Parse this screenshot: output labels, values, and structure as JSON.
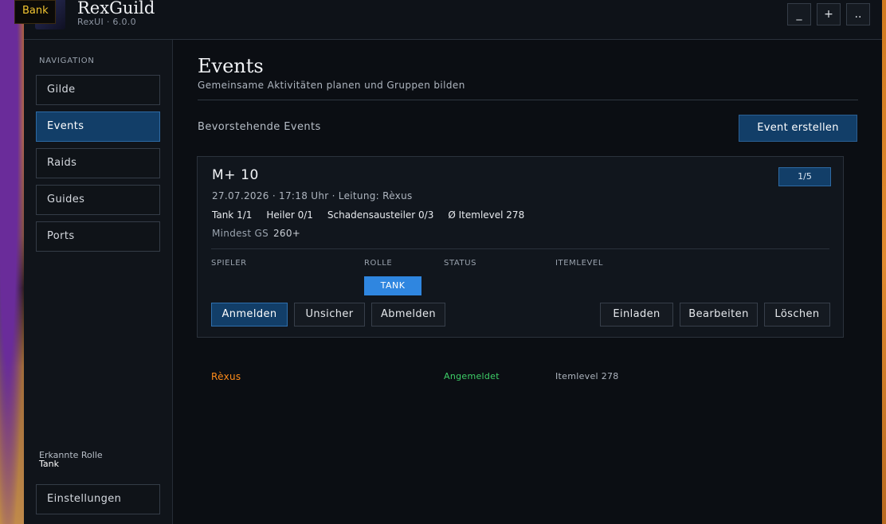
{
  "bank_tag": "Bank",
  "app": {
    "title": "RexGuild",
    "version": "RexUI · 6.0.0"
  },
  "window_controls": {
    "minimize": "_",
    "maximize": "+",
    "more": ".."
  },
  "sidebar": {
    "heading": "NAVIGATION",
    "items": [
      {
        "label": "Gilde"
      },
      {
        "label": "Events",
        "active": true
      },
      {
        "label": "Raids"
      },
      {
        "label": "Guides"
      },
      {
        "label": "Ports"
      }
    ],
    "role_label": "Erkannte Rolle",
    "role_value": "Tank",
    "settings_label": "Einstellungen"
  },
  "page": {
    "title": "Events",
    "subtitle": "Gemeinsame Aktivitäten planen und Gruppen bilden",
    "section_title": "Bevorstehende Events",
    "create_button": "Event erstellen"
  },
  "event": {
    "title": "M+ 10",
    "count": "1/5",
    "meta": "27.07.2026 · 17:18 Uhr · Leitung: Rèxus",
    "composition": {
      "tank": "Tank 1/1",
      "healer": "Heiler 0/1",
      "dps": "Schadensausteiler 0/3",
      "ilvl": "Ø Itemlevel 278"
    },
    "min_gear_label": "Mindest GS",
    "min_gear_value": "260+",
    "columns": {
      "player": "SPIELER",
      "role": "ROLLE",
      "status": "STATUS",
      "ilvl": "ITEMLEVEL"
    },
    "role_badge": "TANK",
    "actions": {
      "signup": "Anmelden",
      "unsure": "Unsicher",
      "signoff": "Abmelden",
      "invite": "Einladen",
      "edit": "Bearbeiten",
      "delete": "Löschen"
    }
  },
  "roster": [
    {
      "name": "Rèxus",
      "status": "Angemeldet",
      "ilvl": "Itemlevel 278"
    }
  ],
  "colors": {
    "accent": "#123e68",
    "tank_badge": "#2f86e0",
    "player_name": "#ff8c1a",
    "status_signed": "#3ecf68",
    "bank_text": "#f2c531"
  }
}
